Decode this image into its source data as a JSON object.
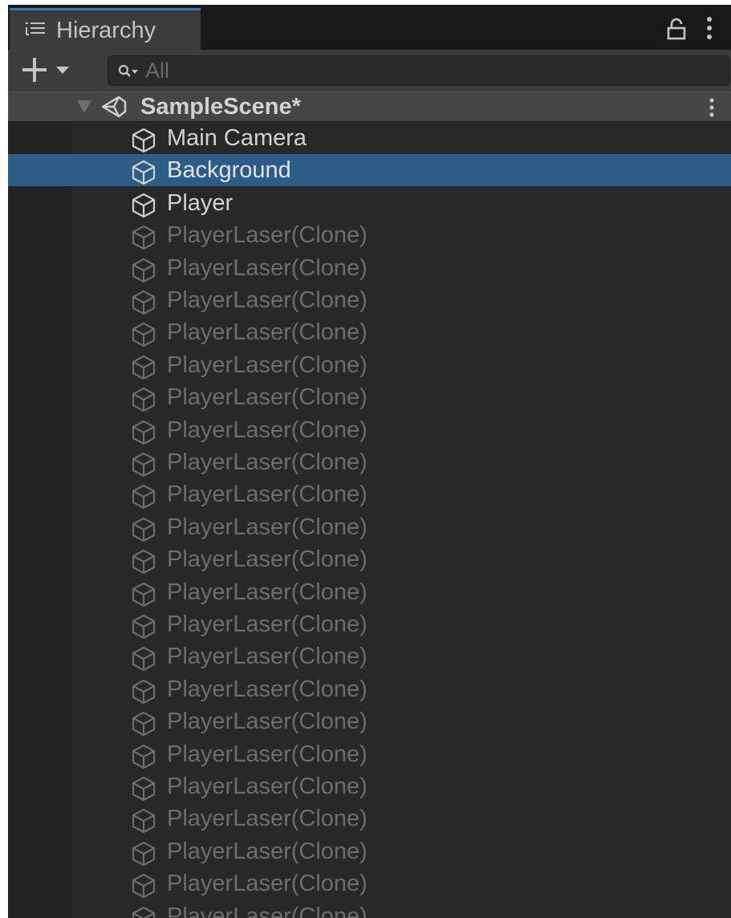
{
  "window": {
    "tab_title": "Hierarchy"
  },
  "toolbar": {
    "search_placeholder": "All"
  },
  "scene": {
    "name": "SampleScene*"
  },
  "items": [
    {
      "label": "Main Camera",
      "state": "active"
    },
    {
      "label": "Background",
      "state": "selected"
    },
    {
      "label": "Player",
      "state": "active"
    },
    {
      "label": "PlayerLaser(Clone)",
      "state": "inactive"
    },
    {
      "label": "PlayerLaser(Clone)",
      "state": "inactive"
    },
    {
      "label": "PlayerLaser(Clone)",
      "state": "inactive"
    },
    {
      "label": "PlayerLaser(Clone)",
      "state": "inactive"
    },
    {
      "label": "PlayerLaser(Clone)",
      "state": "inactive"
    },
    {
      "label": "PlayerLaser(Clone)",
      "state": "inactive"
    },
    {
      "label": "PlayerLaser(Clone)",
      "state": "inactive"
    },
    {
      "label": "PlayerLaser(Clone)",
      "state": "inactive"
    },
    {
      "label": "PlayerLaser(Clone)",
      "state": "inactive"
    },
    {
      "label": "PlayerLaser(Clone)",
      "state": "inactive"
    },
    {
      "label": "PlayerLaser(Clone)",
      "state": "inactive"
    },
    {
      "label": "PlayerLaser(Clone)",
      "state": "inactive"
    },
    {
      "label": "PlayerLaser(Clone)",
      "state": "inactive"
    },
    {
      "label": "PlayerLaser(Clone)",
      "state": "inactive"
    },
    {
      "label": "PlayerLaser(Clone)",
      "state": "inactive"
    },
    {
      "label": "PlayerLaser(Clone)",
      "state": "inactive"
    },
    {
      "label": "PlayerLaser(Clone)",
      "state": "inactive"
    },
    {
      "label": "PlayerLaser(Clone)",
      "state": "inactive"
    },
    {
      "label": "PlayerLaser(Clone)",
      "state": "inactive"
    },
    {
      "label": "PlayerLaser(Clone)",
      "state": "inactive"
    },
    {
      "label": "PlayerLaser(Clone)",
      "state": "inactive"
    },
    {
      "label": "PlayerLaser(Clone)",
      "state": "inactive"
    }
  ],
  "icons": {
    "tab": "hierarchy-list-icon",
    "lock": "lock-icon",
    "menu": "kebab-menu-icon",
    "add": "plus-dropdown-icon",
    "search": "search-filter-icon",
    "scene": "unity-scene-icon",
    "gameobject": "cube-icon"
  },
  "colors": {
    "panel_bg": "#282828",
    "selection": "#2c5d87",
    "tab_accent": "#3a79bb",
    "active_text": "#d2d2d2",
    "inactive_text": "#6d6d6d"
  }
}
